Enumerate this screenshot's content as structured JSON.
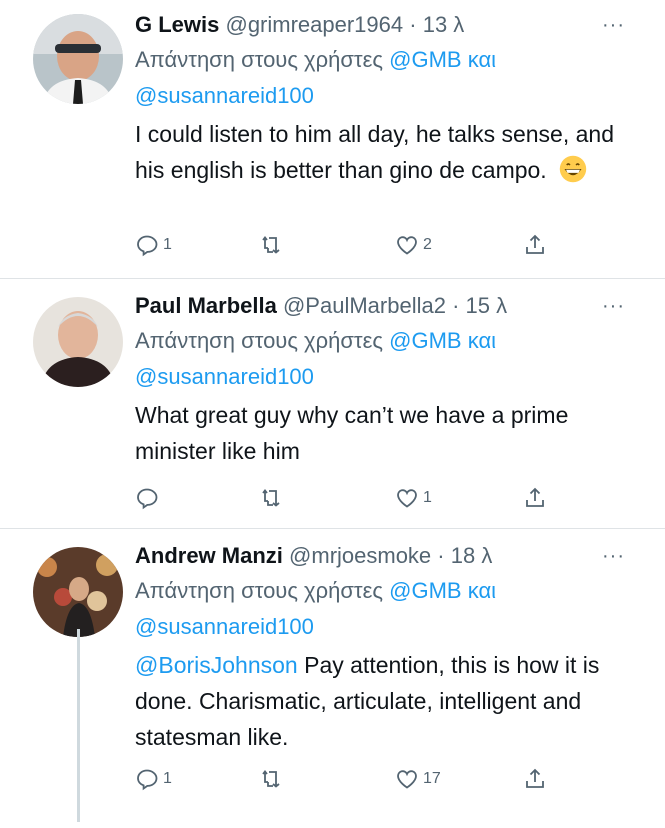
{
  "tweets": [
    {
      "name": "G Lewis",
      "handle": "@grimreaper1964",
      "time": "· 13 λ",
      "reply_prefix": "Απάντηση στους χρήστες",
      "reply_to_1": "@GMB",
      "reply_conj": "και",
      "reply_to_2": "@susannareid100",
      "text": "I could listen to him all day, he talks sense, and his english is better than gino de campo.",
      "replies": "1",
      "retweets": "",
      "likes": "2",
      "more": "···"
    },
    {
      "name": "Paul Marbella",
      "handle": "@PaulMarbella2",
      "time": "· 15 λ",
      "reply_prefix": "Απάντηση στους χρήστες",
      "reply_to_1": "@GMB",
      "reply_conj": "και",
      "reply_to_2": "@susannareid100",
      "text": "What great guy why can’t we have a prime minister like him",
      "replies": "",
      "retweets": "",
      "likes": "1",
      "more": "···"
    },
    {
      "name": "Andrew Manzi",
      "handle": "@mrjoesmoke",
      "time": "· 18 λ",
      "reply_prefix": "Απάντηση στους χρήστες",
      "reply_to_1": "@GMB",
      "reply_conj": "και",
      "reply_to_2": "@susannareid100",
      "mention": "@BorisJohnson",
      "text": "Pay attention, this is how it is done. Charismatic, articulate, intelligent and statesman like.",
      "replies": "1",
      "retweets": "",
      "likes": "17",
      "more": "···"
    }
  ],
  "icons": {
    "reply": "reply-icon",
    "retweet": "retweet-icon",
    "like": "heart-icon",
    "share": "share-icon",
    "emoji": "grinning-face-emoji"
  },
  "colors": {
    "link": "#1d9bf0",
    "secondary_text": "#536471",
    "divider": "#dfe3e6",
    "thread_line": "#cfd9de"
  }
}
